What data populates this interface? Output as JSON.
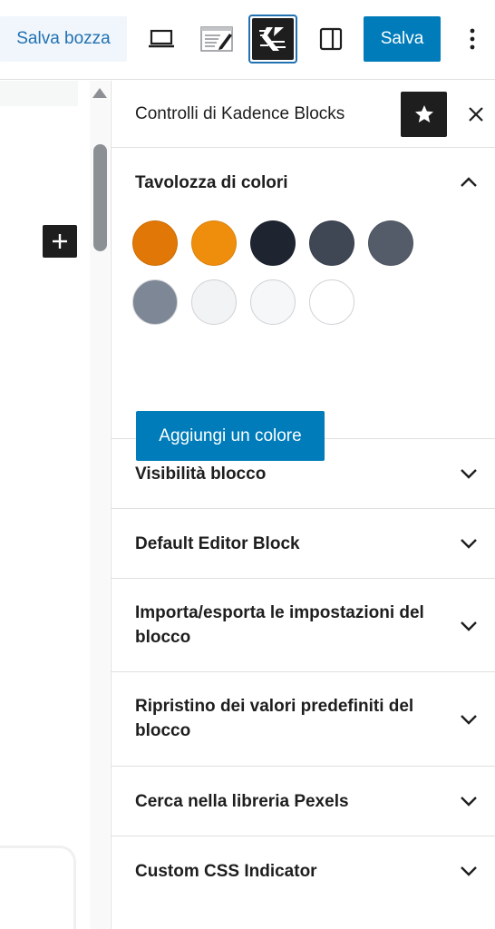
{
  "toolbar": {
    "save_draft_label": "Salva bozza",
    "save_label": "Salva",
    "icons": [
      "desktop-preview-icon",
      "preview-icon",
      "kadence-icon",
      "sidebar-toggle-icon",
      "more-options-icon"
    ]
  },
  "sidebar": {
    "title": "Controlli di Kadence Blocks",
    "palette": {
      "title": "Tavolozza di colori",
      "colors": [
        "#e07706",
        "#ee8e0c",
        "#1e2430",
        "#3f4754",
        "#535c68",
        "#7e8795",
        "#f2f3f5",
        "#f6f7f9",
        "#ffffff"
      ],
      "add_label": "Aggiungi un colore"
    },
    "panels": [
      {
        "label": "Visibilità blocco"
      },
      {
        "label": "Default Editor Block"
      },
      {
        "label": "Importa/esporta le impostazioni del blocco"
      },
      {
        "label": "Ripristino dei valori predefiniti del blocco"
      },
      {
        "label": "Cerca nella libreria Pexels"
      },
      {
        "label": "Custom CSS Indicator"
      }
    ]
  },
  "colors": {
    "accent": "#007cba",
    "dark": "#1e1e1e",
    "draft_bg": "#f0f6fc",
    "draft_text": "#2271b1"
  }
}
